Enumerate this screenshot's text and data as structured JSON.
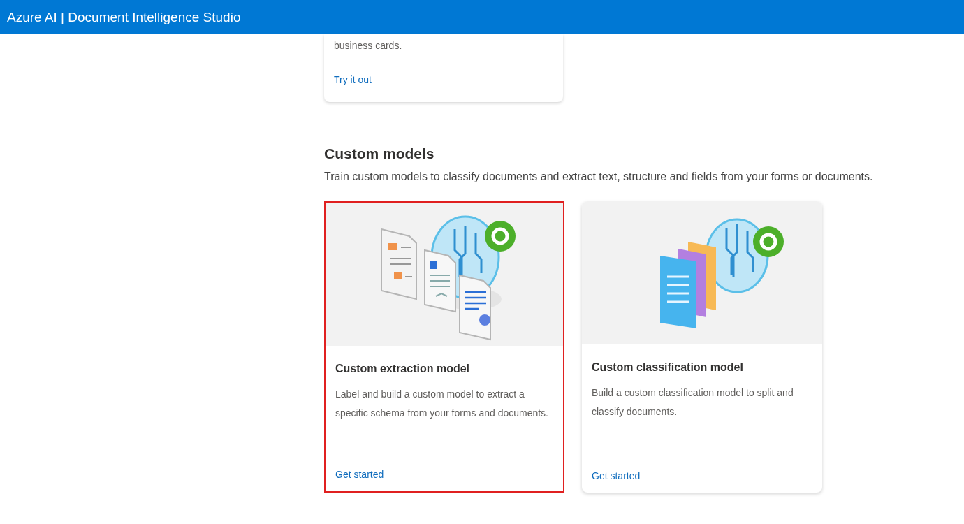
{
  "header": {
    "title": "Azure AI | Document Intelligence Studio"
  },
  "top_card": {
    "description": "business cards.",
    "link": "Try it out"
  },
  "section": {
    "title": "Custom models",
    "description": "Train custom models to classify documents and extract text, structure and fields from your forms or documents."
  },
  "cards": [
    {
      "kind": "extraction",
      "title": "Custom extraction model",
      "description": "Label and build a custom model to extract a specific schema from your forms and documents.",
      "link": "Get started",
      "highlighted": true
    },
    {
      "kind": "classification",
      "title": "Custom classification model",
      "description": "Build a custom classification model to split and classify documents.",
      "link": "Get started",
      "highlighted": false
    }
  ]
}
